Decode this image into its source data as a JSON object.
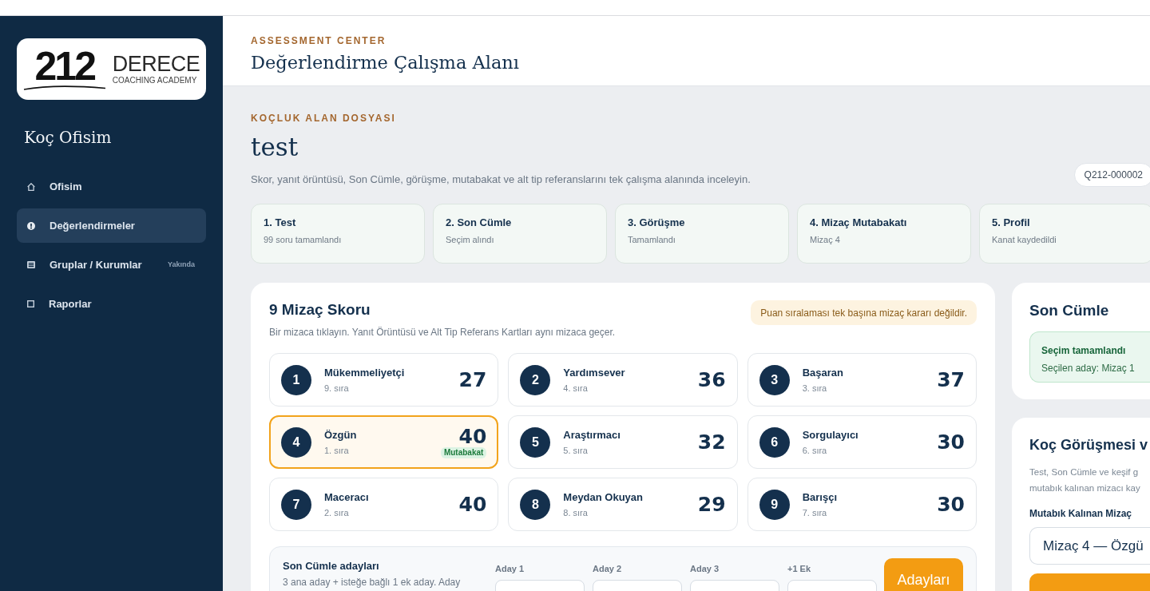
{
  "sidebar": {
    "logo": {
      "number": "212",
      "word": "DERECE",
      "tagline": "COACHING ACADEMY"
    },
    "title": "Koç Ofisim",
    "items": [
      {
        "label": "Ofisim",
        "kind": "home",
        "selected": false
      },
      {
        "label": "Değerlendirmeler",
        "kind": "info",
        "selected": true
      },
      {
        "label": "Gruplar / Kurumlar",
        "kind": "list",
        "selected": false,
        "badge": "Yakında"
      },
      {
        "label": "Raporlar",
        "kind": "square",
        "selected": false
      }
    ]
  },
  "header": {
    "eyebrow": "ASSESSMENT CENTER",
    "title": "Değerlendirme Çalışma Alanı"
  },
  "file": {
    "eyebrow": "KOÇLUK ALAN DOSYASI",
    "title": "test",
    "description": "Skor, yanıt örüntüsü, Son Cümle, görüşme, mutabakat ve alt tip referanslarını tek çalışma alanında inceleyin.",
    "code": "Q212-000002"
  },
  "steps": [
    {
      "title": "1. Test",
      "status": "99 soru tamamlandı"
    },
    {
      "title": "2. Son Cümle",
      "status": "Seçim alındı"
    },
    {
      "title": "3. Görüşme",
      "status": "Tamamlandı"
    },
    {
      "title": "4. Mizaç Mutabakatı",
      "status": "Mizaç 4"
    },
    {
      "title": "5. Profil",
      "status": "Kanat kaydedildi"
    }
  ],
  "scores": {
    "title": "9 Mizaç Skoru",
    "subtitle": "Bir mizaca tıklayın. Yanıt Örüntüsü ve Alt Tip Referans Kartları aynı mizaca geçer.",
    "notice": "Puan sıralaması tek başına mizaç kararı değildir.",
    "items": [
      {
        "number": "1",
        "name": "Mükemmeliyetçi",
        "rank": "9. sıra",
        "score": "27",
        "selected": false
      },
      {
        "number": "2",
        "name": "Yardımsever",
        "rank": "4. sıra",
        "score": "36",
        "selected": false
      },
      {
        "number": "3",
        "name": "Başaran",
        "rank": "3. sıra",
        "score": "37",
        "selected": false
      },
      {
        "number": "4",
        "name": "Özgün",
        "rank": "1. sıra",
        "score": "40",
        "selected": true,
        "badge": "Mutabakat"
      },
      {
        "number": "5",
        "name": "Araştırmacı",
        "rank": "5. sıra",
        "score": "32",
        "selected": false
      },
      {
        "number": "6",
        "name": "Sorgulayıcı",
        "rank": "6. sıra",
        "score": "30",
        "selected": false
      },
      {
        "number": "7",
        "name": "Maceracı",
        "rank": "2. sıra",
        "score": "40",
        "selected": false
      },
      {
        "number": "8",
        "name": "Meydan Okuyan",
        "rank": "8. sıra",
        "score": "29",
        "selected": false
      },
      {
        "number": "9",
        "name": "Barışçı",
        "rank": "7. sıra",
        "score": "30",
        "selected": false
      }
    ]
  },
  "candidates": {
    "title": "Son Cümle adayları",
    "note": "3 ana aday + isteğe bağlı 1 ek aday. Aday",
    "fields": [
      {
        "label": "Aday 1"
      },
      {
        "label": "Aday 2"
      },
      {
        "label": "Aday 3"
      },
      {
        "label": "+1 Ek"
      }
    ],
    "button": "Adayları"
  },
  "last_sentence": {
    "title": "Son Cümle",
    "status_title": "Seçim tamamlandı",
    "status_text": "Seçilen aday: Mizaç 1"
  },
  "interview": {
    "title": "Koç Görüşmesi v",
    "description_lines": [
      "Test, Son Cümle ve keşif g",
      "mutabık kalınan mizacı kay"
    ],
    "field_label": "Mutabık Kalınan Mizaç",
    "field_value": "Mizaç 4 — Özgü"
  }
}
